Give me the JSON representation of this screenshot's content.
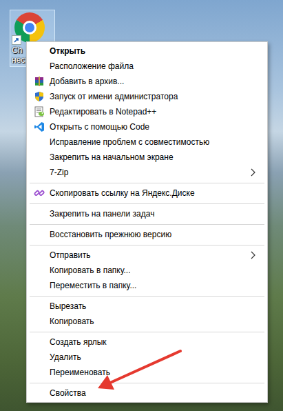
{
  "desktop_icon": {
    "label_lines": [
      "Ch",
      "несп"
    ],
    "selected": true
  },
  "context_menu": {
    "items": [
      {
        "kind": "item",
        "label": "Открыть",
        "default": true,
        "has_submenu": false
      },
      {
        "kind": "item",
        "label": "Расположение файла",
        "default": false,
        "has_submenu": false
      },
      {
        "kind": "item",
        "label": "Добавить в архив...",
        "default": false,
        "has_submenu": false
      },
      {
        "kind": "item",
        "label": "Запуск от имени администратора",
        "default": false,
        "has_submenu": false
      },
      {
        "kind": "item",
        "label": "Редактировать в Notepad++",
        "default": false,
        "has_submenu": false
      },
      {
        "kind": "item",
        "label": "Открыть с помощью Code",
        "default": false,
        "has_submenu": false
      },
      {
        "kind": "item",
        "label": "Исправление проблем с совместимостью",
        "default": false,
        "has_submenu": false
      },
      {
        "kind": "item",
        "label": "Закрепить на начальном экране",
        "default": false,
        "has_submenu": false
      },
      {
        "kind": "item",
        "label": "7-Zip",
        "default": false,
        "has_submenu": true
      },
      {
        "kind": "separator"
      },
      {
        "kind": "item",
        "label": "Скопировать ссылку на Яндекс.Диске",
        "default": false,
        "has_submenu": false
      },
      {
        "kind": "separator"
      },
      {
        "kind": "item",
        "label": "Закрепить на панели задач",
        "default": false,
        "has_submenu": false
      },
      {
        "kind": "separator"
      },
      {
        "kind": "item",
        "label": "Восстановить прежнюю версию",
        "default": false,
        "has_submenu": false
      },
      {
        "kind": "separator"
      },
      {
        "kind": "item",
        "label": "Отправить",
        "default": false,
        "has_submenu": true
      },
      {
        "kind": "item",
        "label": "Копировать в папку...",
        "default": false,
        "has_submenu": false
      },
      {
        "kind": "item",
        "label": "Переместить в папку...",
        "default": false,
        "has_submenu": false
      },
      {
        "kind": "separator"
      },
      {
        "kind": "item",
        "label": "Вырезать",
        "default": false,
        "has_submenu": false
      },
      {
        "kind": "item",
        "label": "Копировать",
        "default": false,
        "has_submenu": false
      },
      {
        "kind": "separator"
      },
      {
        "kind": "item",
        "label": "Создать ярлык",
        "default": false,
        "has_submenu": false
      },
      {
        "kind": "item",
        "label": "Удалить",
        "default": false,
        "has_submenu": false
      },
      {
        "kind": "item",
        "label": "Переименовать",
        "default": false,
        "has_submenu": false
      },
      {
        "kind": "separator"
      },
      {
        "kind": "item",
        "label": "Свойства",
        "default": false,
        "has_submenu": false
      }
    ]
  }
}
